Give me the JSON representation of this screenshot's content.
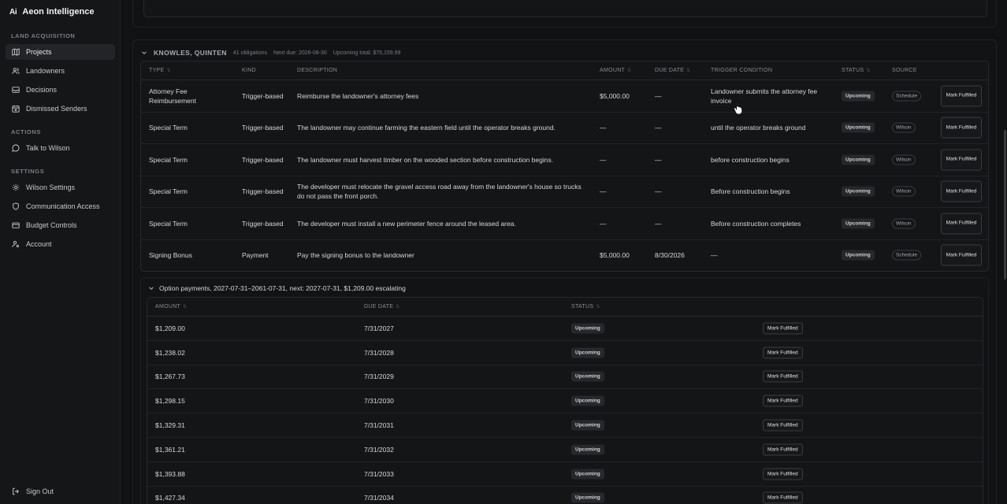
{
  "app": {
    "logo": "Ai",
    "name": "Aeon Intelligence"
  },
  "sidebar": {
    "sections": [
      {
        "label": "LAND ACQUISITION"
      },
      {
        "label": "ACTIONS"
      },
      {
        "label": "SETTINGS"
      }
    ],
    "items": [
      {
        "label": "Projects",
        "icon": "map-icon"
      },
      {
        "label": "Landowners",
        "icon": "users-icon"
      },
      {
        "label": "Decisions",
        "icon": "inbox-icon"
      },
      {
        "label": "Dismissed Senders",
        "icon": "calendar-x-icon"
      },
      {
        "label": "Talk to Wilson",
        "icon": "chat-icon"
      },
      {
        "label": "Wilson Settings",
        "icon": "gear-icon"
      },
      {
        "label": "Communication Access",
        "icon": "shield-icon"
      },
      {
        "label": "Budget Controls",
        "icon": "card-icon"
      },
      {
        "label": "Account",
        "icon": "user-cog-icon"
      }
    ],
    "sign_out": "Sign Out"
  },
  "group": {
    "title": "KNOWLES, QUINTEN",
    "obligations": "41 obligations",
    "next_due": "Next due: 2026-08-30",
    "upcoming_total": "Upcoming total: $75,159.99"
  },
  "table": {
    "columns": [
      "TYPE",
      "KIND",
      "DESCRIPTION",
      "AMOUNT",
      "DUE DATE",
      "TRIGGER CONDITION",
      "STATUS",
      "SOURCE"
    ],
    "rows": [
      {
        "type": "Attorney Fee Reimbursement",
        "kind": "Trigger-based",
        "description": "Reimburse the landowner's attorney fees",
        "amount": "$5,000.00",
        "due": "—",
        "trigger": "Landowner submits the attorney fee invoice",
        "status": "Upcoming",
        "source": "Schedule",
        "action": "Mark Fulfilled"
      },
      {
        "type": "Special Term",
        "kind": "Trigger-based",
        "description": "The landowner may continue farming the eastern field until the operator breaks ground.",
        "amount": "—",
        "due": "—",
        "trigger": "until the operator breaks ground",
        "status": "Upcoming",
        "source": "Wilson",
        "action": "Mark Fulfilled"
      },
      {
        "type": "Special Term",
        "kind": "Trigger-based",
        "description": "The landowner must harvest timber on the wooded section before construction begins.",
        "amount": "—",
        "due": "—",
        "trigger": "before construction begins",
        "status": "Upcoming",
        "source": "Wilson",
        "action": "Mark Fulfilled"
      },
      {
        "type": "Special Term",
        "kind": "Trigger-based",
        "description": "The developer must relocate the gravel access road away from the landowner's house so trucks do not pass the front porch.",
        "amount": "—",
        "due": "—",
        "trigger": "Before construction begins",
        "status": "Upcoming",
        "source": "Wilson",
        "action": "Mark Fulfilled"
      },
      {
        "type": "Special Term",
        "kind": "Trigger-based",
        "description": "The developer must install a new perimeter fence around the leased area.",
        "amount": "—",
        "due": "—",
        "trigger": "Before construction completes",
        "status": "Upcoming",
        "source": "Wilson",
        "action": "Mark Fulfilled"
      },
      {
        "type": "Signing Bonus",
        "kind": "Payment",
        "description": "Pay the signing bonus to the landowner",
        "amount": "$5,000.00",
        "due": "8/30/2026",
        "trigger": "—",
        "status": "Upcoming",
        "source": "Schedule",
        "action": "Mark Fulfilled"
      }
    ]
  },
  "option_payments": {
    "header": "Option payments, 2027-07-31–2061-07-31, next: 2027-07-31, $1,209.00 escalating",
    "columns": [
      "AMOUNT",
      "DUE DATE",
      "STATUS"
    ],
    "rows": [
      {
        "amount": "$1,209.00",
        "due": "7/31/2027",
        "status": "Upcoming",
        "action": "Mark Fulfilled"
      },
      {
        "amount": "$1,238.02",
        "due": "7/31/2028",
        "status": "Upcoming",
        "action": "Mark Fulfilled"
      },
      {
        "amount": "$1,267.73",
        "due": "7/31/2029",
        "status": "Upcoming",
        "action": "Mark Fulfilled"
      },
      {
        "amount": "$1,298.15",
        "due": "7/31/2030",
        "status": "Upcoming",
        "action": "Mark Fulfilled"
      },
      {
        "amount": "$1,329.31",
        "due": "7/31/2031",
        "status": "Upcoming",
        "action": "Mark Fulfilled"
      },
      {
        "amount": "$1,361.21",
        "due": "7/31/2032",
        "status": "Upcoming",
        "action": "Mark Fulfilled"
      },
      {
        "amount": "$1,393.88",
        "due": "7/31/2033",
        "status": "Upcoming",
        "action": "Mark Fulfilled"
      },
      {
        "amount": "$1,427.34",
        "due": "7/31/2034",
        "status": "Upcoming",
        "action": "Mark Fulfilled"
      }
    ]
  },
  "colors": {
    "background": "#111214",
    "sidebar": "#151618",
    "border": "#26282b",
    "badge": "#26282b"
  }
}
